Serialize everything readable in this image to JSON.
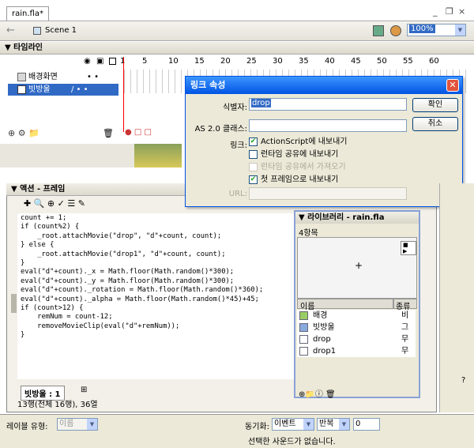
{
  "document": {
    "tab": "rain.fla*",
    "win_controls": [
      "_",
      "❐",
      "×"
    ]
  },
  "scene_bar": {
    "scene_label": "Scene 1",
    "zoom": "100%"
  },
  "timeline": {
    "title": "▼ 타임라인",
    "frame_numbers": [
      "1",
      "5",
      "10",
      "15",
      "20",
      "25",
      "30",
      "35",
      "40",
      "45",
      "50",
      "55",
      "60"
    ],
    "layers": [
      {
        "name": "배경화면",
        "selected": false
      },
      {
        "name": "빗방울",
        "selected": true
      }
    ]
  },
  "link_dialog": {
    "title": "링크 속성",
    "id_label": "식별자:",
    "id_value": "drop",
    "class_label": "AS 2.0 클래스:",
    "class_value": "",
    "link_label": "링크:",
    "ok": "확인",
    "cancel": "취소",
    "checks": [
      {
        "label": "ActionScript에 내보내기",
        "checked": true,
        "disabled": false
      },
      {
        "label": "런타임 공유에 내보내기",
        "checked": false,
        "disabled": false
      },
      {
        "label": "런타임 공유에서 가져오기",
        "checked": false,
        "disabled": true
      },
      {
        "label": "첫 프레임으로 내보내기",
        "checked": true,
        "disabled": false
      }
    ],
    "url_label": "URL:"
  },
  "actions_panel": {
    "title": "▼ 액션 - 프레임",
    "code": [
      "count += 1;",
      "if (count%2) {",
      "    _root.attachMovie(\"drop\", \"d\"+count, count);",
      "} else {",
      "    _root.attachMovie(\"drop1\", \"d\"+count, count);",
      "}",
      "eval(\"d\"+count)._x = Math.floor(Math.random()*300);",
      "eval(\"d\"+count)._y = Math.floor(Math.random()*300);",
      "eval(\"d\"+count)._rotation = Math.floor(Math.random()*360);",
      "eval(\"d\"+count)._alpha = Math.floor(Math.random()*45)+45;",
      "if (count>12) {",
      "    remNum = count-12;",
      "    removeMovieClip(eval(\"d\"+remNum));",
      "}"
    ],
    "layer_tab": "빗방울 : 1",
    "status": "13행(전체 16행), 36열"
  },
  "library": {
    "title": "▼ 라이브러리 - rain.fla",
    "count": "4항목",
    "col_name": "이름",
    "col_kind": "종류",
    "items": [
      {
        "name": "배경",
        "kind": "비"
      },
      {
        "name": "빗방울",
        "kind": "그"
      },
      {
        "name": "drop",
        "kind": "무"
      },
      {
        "name": "drop1",
        "kind": "무"
      }
    ]
  },
  "properties": {
    "label_type": "레이블 유형:",
    "label_type_value": "이름",
    "sync_label": "동기화:",
    "sync_value": "이벤트",
    "repeat_value": "반복",
    "repeat_count": "0",
    "sound_status": "선택한 사운드가 없습니다."
  }
}
